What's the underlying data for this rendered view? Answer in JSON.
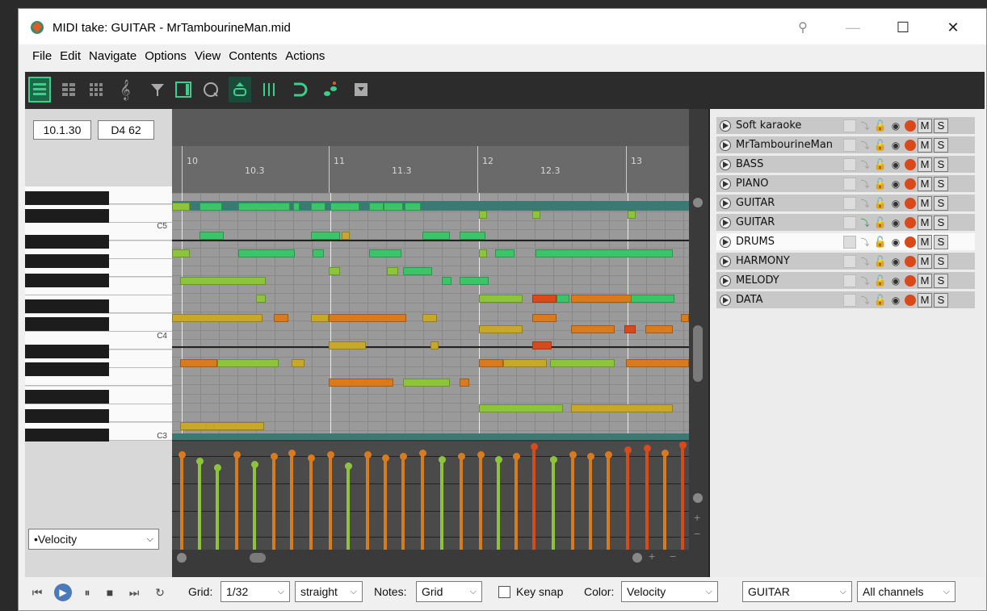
{
  "window": {
    "title": "MIDI take: GUITAR - MrTambourineMan.mid",
    "minimize_glyph": "—",
    "maximize_glyph": "☐",
    "close_glyph": "✕"
  },
  "menu": [
    "File",
    "Edit",
    "Navigate",
    "Options",
    "View",
    "Contents",
    "Actions"
  ],
  "toolbar": {
    "icons": [
      "piano-roll-icon",
      "named-notes-icon",
      "drum-grid-icon",
      "notation-icon",
      "filter-icon",
      "list-view-icon",
      "loop-icon",
      "auto-scroll-icon",
      "grid-icon",
      "snap-icon",
      "step-input-icon",
      "save-icon"
    ]
  },
  "position": {
    "time": "10.1.30",
    "note": "D4 62"
  },
  "ruler": {
    "labels": [
      "10",
      "10.3",
      "11",
      "11.3",
      "12",
      "12.3",
      "13"
    ]
  },
  "piano": {
    "labels": [
      "C5",
      "C4",
      "C3"
    ]
  },
  "cc_lane": {
    "selected": "•Velocity"
  },
  "tracks": [
    {
      "name": "Soft karaoke",
      "selected": false
    },
    {
      "name": "MrTambourineMan",
      "selected": false
    },
    {
      "name": "BASS",
      "selected": false
    },
    {
      "name": "PIANO",
      "selected": false
    },
    {
      "name": "GUITAR",
      "selected": false
    },
    {
      "name": "GUITAR",
      "selected": false
    },
    {
      "name": "DRUMS",
      "selected": true
    },
    {
      "name": "HARMONY",
      "selected": false
    },
    {
      "name": "MELODY",
      "selected": false
    },
    {
      "name": "DATA",
      "selected": false
    }
  ],
  "track_buttons": {
    "mute": "M",
    "solo": "S"
  },
  "bottom": {
    "grid_label": "Grid:",
    "grid_value": "1/32",
    "swing_value": "straight",
    "notes_label": "Notes:",
    "notes_value": "Grid",
    "keysnap_label": "Key snap",
    "color_label": "Color:",
    "color_value": "Velocity",
    "track_value": "GUITAR",
    "channel_value": "All channels"
  },
  "colors": {
    "note_green": "#3cc468",
    "note_lime": "#8cc43c",
    "note_yellow": "#c8a82a",
    "note_orange": "#d87a1e",
    "note_red": "#d84a1a",
    "accent_green": "#20a050"
  }
}
